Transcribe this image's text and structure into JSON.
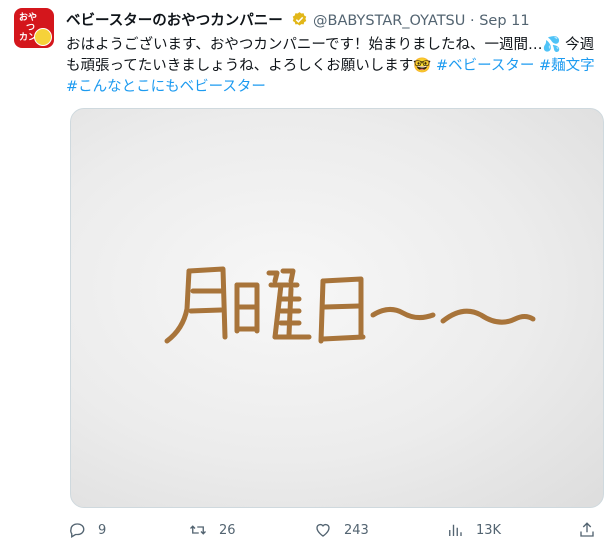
{
  "tweet": {
    "display_name": "ベビースターのおやつカンパニー",
    "handle": "@BABYSTAR_OYATSU",
    "separator": "·",
    "date": "Sep 11",
    "text_main": "おはようございます、おやつカンパニーです！始まりましたね、一週間…💦 今週も頑張ってたいきましょうね、よろしくお願いします🤓 ",
    "hashtags": [
      "#ベビースター",
      "#麺文字",
      "#こんなとこにもベビースター"
    ],
    "avatar": {
      "line1": "おや",
      "line2": "つ",
      "line3": "カンパ"
    },
    "media": {
      "noodle_text": "月曜日〜",
      "noodle_color": "#a8743a"
    },
    "metrics": {
      "replies": "9",
      "retweets": "26",
      "likes": "243",
      "views": "13K"
    }
  },
  "colors": {
    "link": "#1d9bf0",
    "secondary": "#536471",
    "verified": "#e2b719"
  }
}
